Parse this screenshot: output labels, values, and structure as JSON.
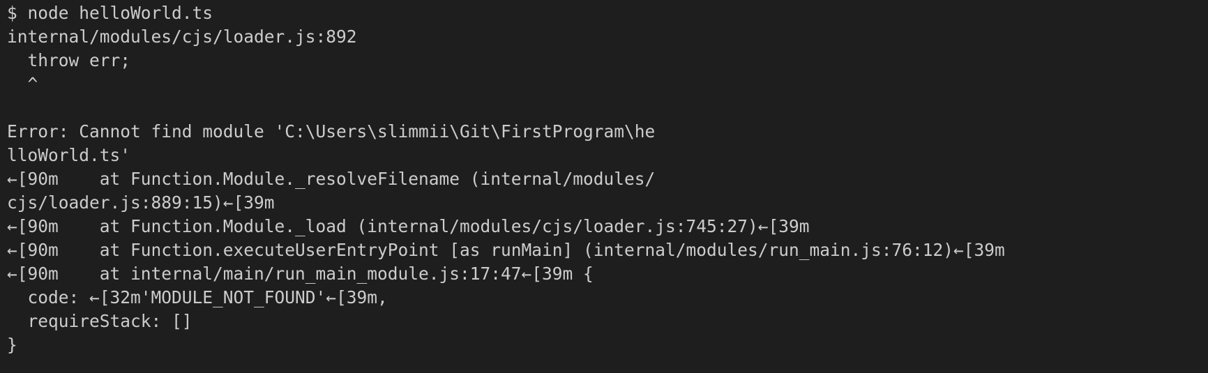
{
  "terminal": {
    "lines": [
      "$ node helloWorld.ts",
      "internal/modules/cjs/loader.js:892",
      "  throw err;",
      "  ^",
      "",
      "Error: Cannot find module 'C:\\Users\\slimmii\\Git\\FirstProgram\\he",
      "lloWorld.ts'",
      "←[90m    at Function.Module._resolveFilename (internal/modules/",
      "cjs/loader.js:889:15)←[39m",
      "←[90m    at Function.Module._load (internal/modules/cjs/loader.js:745:27)←[39m",
      "←[90m    at Function.executeUserEntryPoint [as runMain] (internal/modules/run_main.js:76:12)←[39m",
      "←[90m    at internal/main/run_main_module.js:17:47←[39m {",
      "  code: ←[32m'MODULE_NOT_FOUND'←[39m,",
      "  requireStack: []",
      "}"
    ]
  }
}
